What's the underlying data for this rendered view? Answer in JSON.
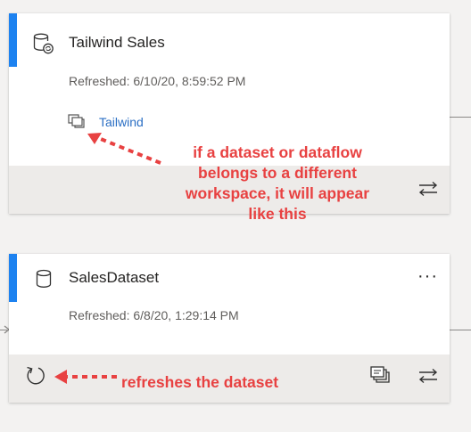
{
  "card1": {
    "title": "Tailwind Sales",
    "refreshed": "Refreshed: 6/10/20, 8:59:52 PM",
    "workspace_link": "Tailwind",
    "icons": [
      "dataset-shared-icon",
      "workspace-icon",
      "swap-icon"
    ]
  },
  "card2": {
    "title": "SalesDataset",
    "refreshed": "Refreshed: 6/8/20, 1:29:14 PM",
    "more_label": "···",
    "icons": [
      "dataset-icon",
      "refresh-icon",
      "compare-icon",
      "swap-icon"
    ]
  },
  "annotations": {
    "workspace_note_lines": [
      "if a dataset or dataflow",
      "belongs to a different",
      "workspace, it will appear",
      "like this"
    ],
    "refresh_note": "refreshes the dataset"
  },
  "colors": {
    "accent": "#1d82f0",
    "annotation": "#e84141",
    "link": "#2b6fc4",
    "footer": "#edebe9",
    "background": "#f3f2f1"
  }
}
